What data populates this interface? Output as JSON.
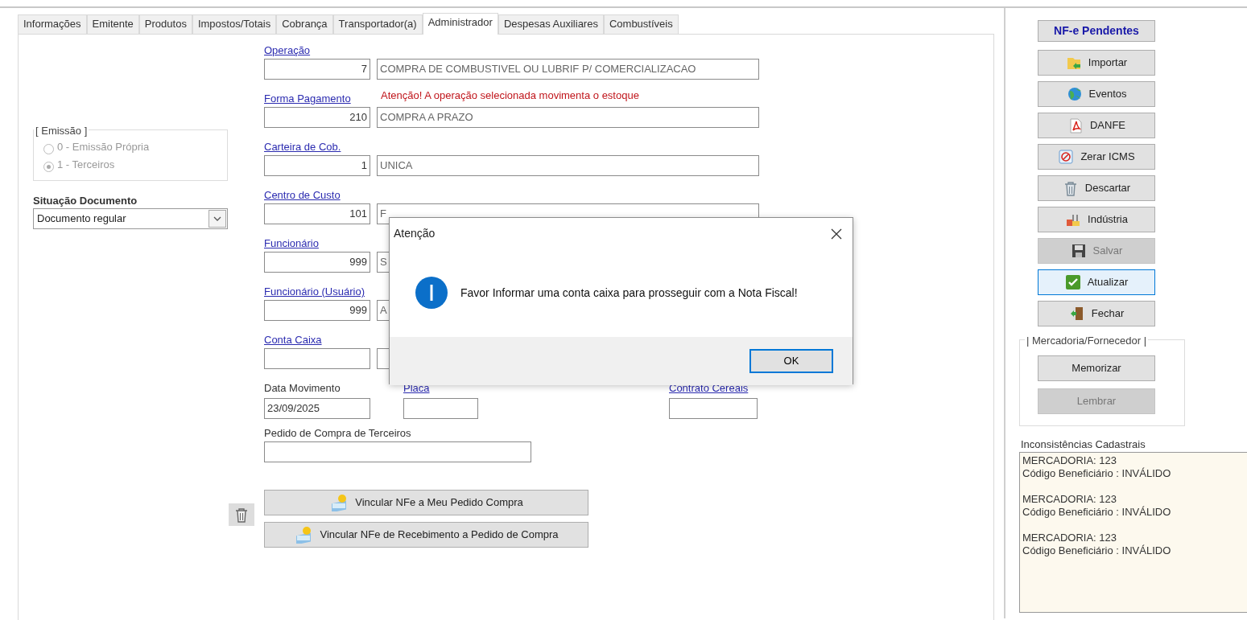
{
  "tabs": [
    {
      "label": "Informações",
      "selected": false
    },
    {
      "label": "Emitente",
      "selected": false
    },
    {
      "label": "Produtos",
      "selected": false
    },
    {
      "label": "Impostos/Totais",
      "selected": false
    },
    {
      "label": "Cobrança",
      "selected": false
    },
    {
      "label": "Transportador(a)",
      "selected": false
    },
    {
      "label": "Administrador",
      "selected": true
    },
    {
      "label": "Despesas Auxiliares",
      "selected": false
    },
    {
      "label": "Combustíveis",
      "selected": false
    }
  ],
  "emission": {
    "title": "[ Emissão ]",
    "disabled": true,
    "options": [
      {
        "label": "0 - Emissão Própria",
        "selected": false
      },
      {
        "label": "1 - Terceiros",
        "selected": true
      }
    ]
  },
  "document_status": {
    "label": "Situação Documento",
    "value": "Documento regular"
  },
  "lookups": [
    {
      "label": "Operação",
      "code": "7",
      "description": "COMPRA DE COMBUSTIVEL OU LUBRIF P/ COMERCIALIZACAO"
    },
    {
      "label": "Forma Pagamento",
      "note": "Atenção! A operação selecionada movimenta o estoque",
      "code": "210",
      "description": "COMPRA A PRAZO"
    },
    {
      "label": "Carteira de Cob.",
      "code": "1",
      "description": "UNICA"
    },
    {
      "label": "Centro de Custo",
      "code": "101",
      "description": "F"
    },
    {
      "label": "Funcionário",
      "code": "999",
      "description": "S"
    },
    {
      "label": "Funcionário (Usuário)",
      "code": "999",
      "description": "A"
    },
    {
      "label": "Conta Caixa"
    }
  ],
  "small_fields": [
    {
      "kind": "plain",
      "label": "Data Movimento",
      "value": "23/09/2025"
    },
    {
      "kind": "link",
      "label": "Placa"
    },
    {
      "kind": "link",
      "label": "Contrato Cereais"
    }
  ],
  "third_party_order": {
    "label": "Pedido de Compra de Terceiros"
  },
  "link_buttons": [
    {
      "label": "Vincular NFe a Meu Pedido Compra"
    },
    {
      "label": "Vincular NFe de Recebimento a Pedido de Compra"
    }
  ],
  "side_buttons": [
    {
      "kind": "header",
      "label": "NF-e Pendentes",
      "disabled": false,
      "focused": false
    },
    {
      "kind": "import",
      "label": "Importar",
      "disabled": false,
      "focused": false
    },
    {
      "kind": "events",
      "label": "Eventos",
      "disabled": false,
      "focused": false
    },
    {
      "kind": "pdf",
      "label": "DANFE",
      "disabled": false,
      "focused": false
    },
    {
      "kind": "zero",
      "label": "Zerar ICMS",
      "disabled": false,
      "focused": false
    },
    {
      "kind": "discard",
      "label": "Descartar",
      "disabled": false,
      "focused": false
    },
    {
      "kind": "industry",
      "label": "Indústria",
      "disabled": false,
      "focused": false
    },
    {
      "kind": "save",
      "label": "Salvar",
      "disabled": true,
      "focused": false
    },
    {
      "kind": "refresh",
      "label": "Atualizar",
      "disabled": false,
      "focused": true
    },
    {
      "kind": "close",
      "label": "Fechar",
      "disabled": false,
      "focused": false
    }
  ],
  "memory_group": {
    "title": "| Mercadoria/Fornecedor |",
    "buttons": [
      {
        "label": "Memorizar",
        "disabled": false
      },
      {
        "label": "Lembrar",
        "disabled": true
      }
    ]
  },
  "inconsistencies": {
    "label": "Inconsistências Cadastrais",
    "entries": [
      {
        "item": "MERCADORIA: 123",
        "detail": "Código Beneficiário : INVÁLIDO"
      },
      {
        "item": "MERCADORIA: 123",
        "detail": "Código Beneficiário : INVÁLIDO"
      },
      {
        "item": "MERCADORIA: 123",
        "detail": "Código Beneficiário : INVÁLIDO"
      }
    ]
  },
  "dialog": {
    "title": "Atenção",
    "message": "Favor Informar uma conta caixa para prosseguir com a Nota Fiscal!",
    "button": "OK"
  }
}
